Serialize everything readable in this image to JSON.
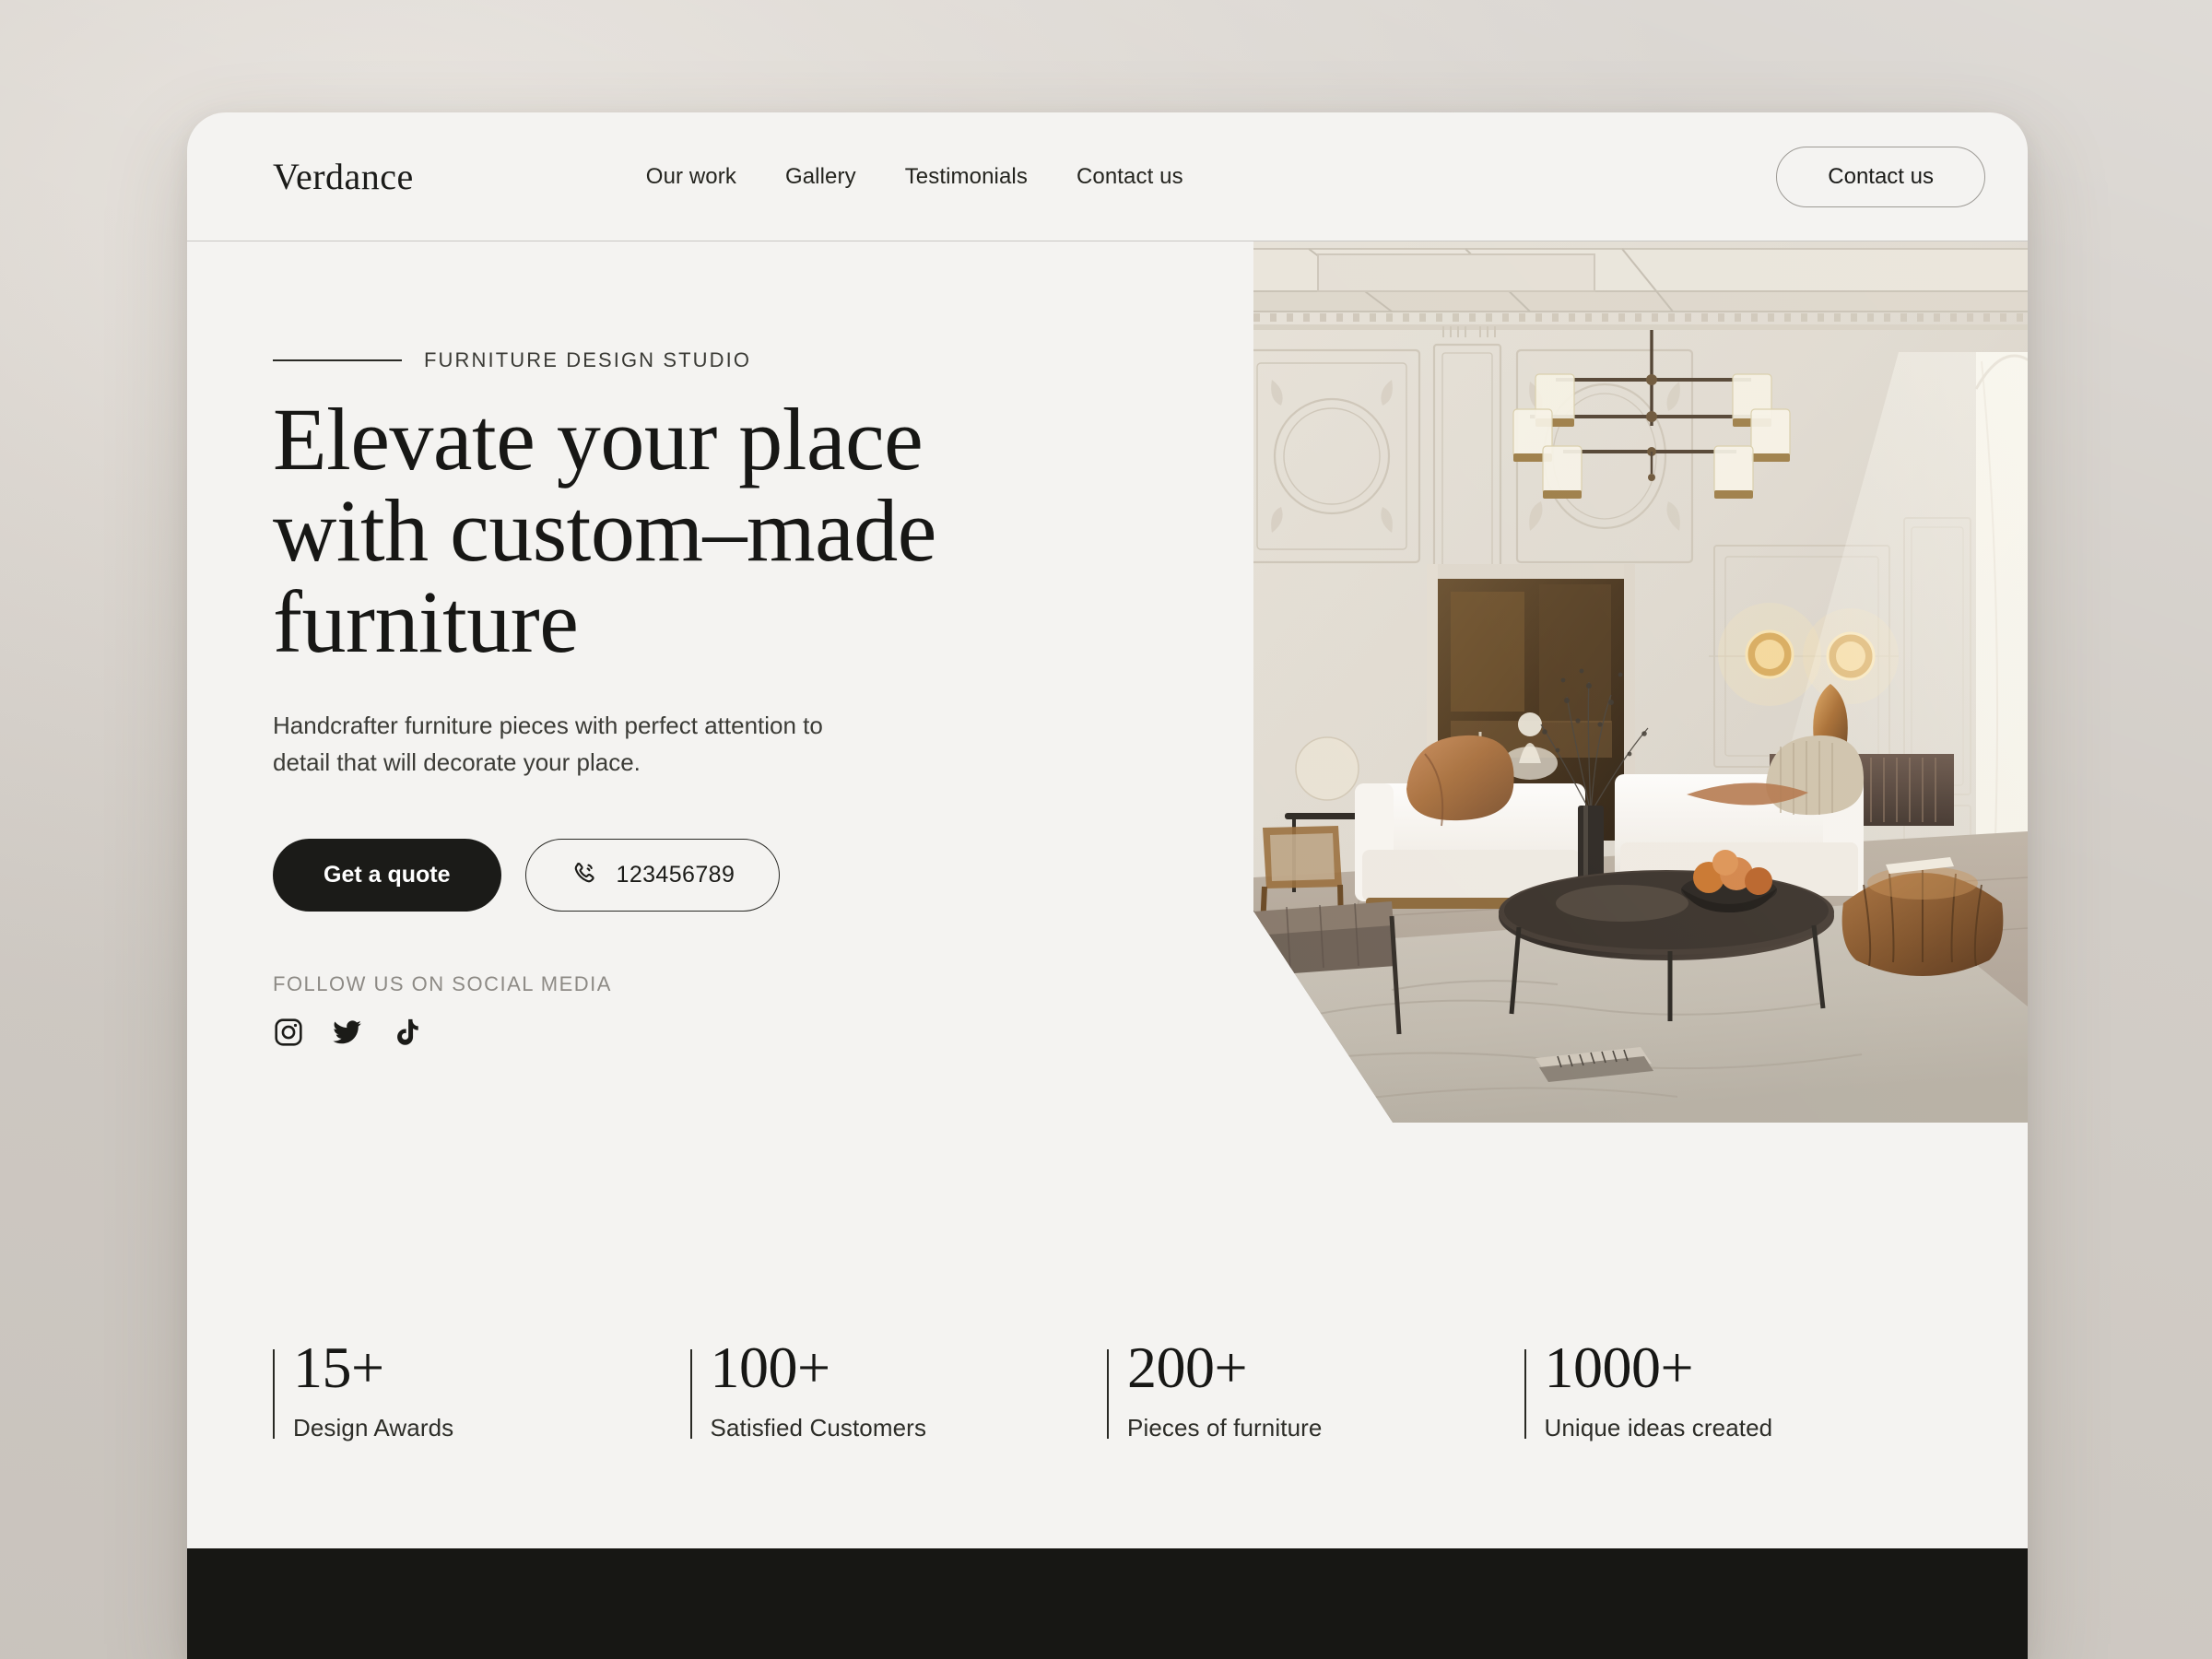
{
  "brand": {
    "logo": "Verdance"
  },
  "nav": {
    "items": [
      {
        "label": "Our work"
      },
      {
        "label": "Gallery"
      },
      {
        "label": "Testimonials"
      },
      {
        "label": "Contact us"
      }
    ],
    "cta_label": "Contact us"
  },
  "hero": {
    "eyebrow": "FURNITURE DESIGN STUDIO",
    "headline": "Elevate your place with custom–made furniture",
    "subtext": "Handcrafter furniture pieces with perfect attention to detail that will decorate your place.",
    "primary_button": "Get a quote",
    "phone_number": "123456789",
    "phone_icon": "phone-ring-icon",
    "social_label": "FOLLOW US ON SOCIAL MEDIA",
    "socials": [
      {
        "name": "instagram-icon"
      },
      {
        "name": "twitter-icon"
      },
      {
        "name": "tiktok-icon"
      }
    ],
    "image_alt": "classical-living-room-interior"
  },
  "stats": [
    {
      "value": "15+",
      "label": "Design Awards"
    },
    {
      "value": "100+",
      "label": "Satisfied Customers"
    },
    {
      "value": "200+",
      "label": "Pieces of furniture"
    },
    {
      "value": "1000+",
      "label": "Unique ideas created"
    }
  ],
  "colors": {
    "page_background": "#f4f3f1",
    "canvas_background": "#ded9d3",
    "ink": "#171715",
    "muted": "#8d8a85",
    "dark_band": "#171714"
  }
}
